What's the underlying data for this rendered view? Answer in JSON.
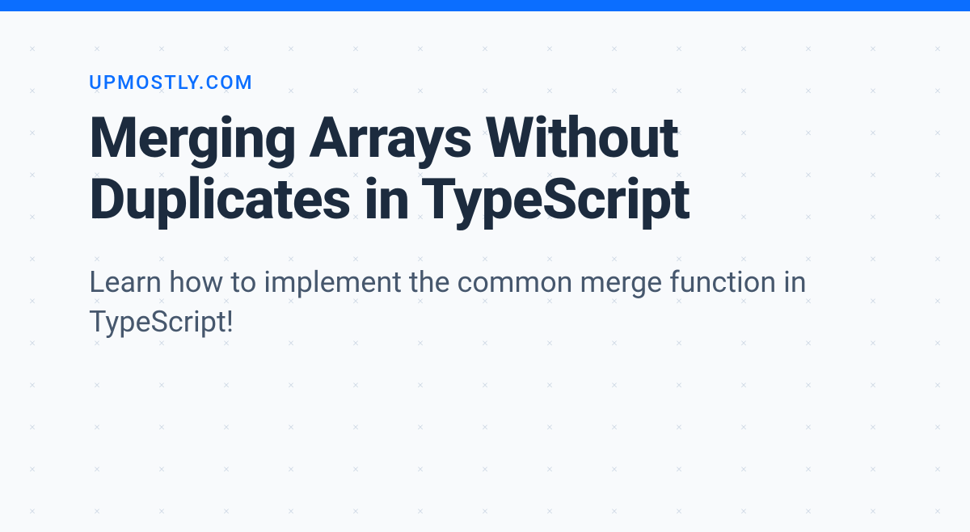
{
  "site_label": "UPMOSTLY.COM",
  "title": "Merging Arrays Without Duplicates in TypeScript",
  "subtitle": "Learn how to implement the common merge function in TypeScript!",
  "pattern_glyph": "×",
  "colors": {
    "accent": "#0b6eff",
    "bg": "#f8fafc",
    "heading": "#1c2b3e",
    "subtitle": "#46576d",
    "pattern": "#cad5e2"
  }
}
